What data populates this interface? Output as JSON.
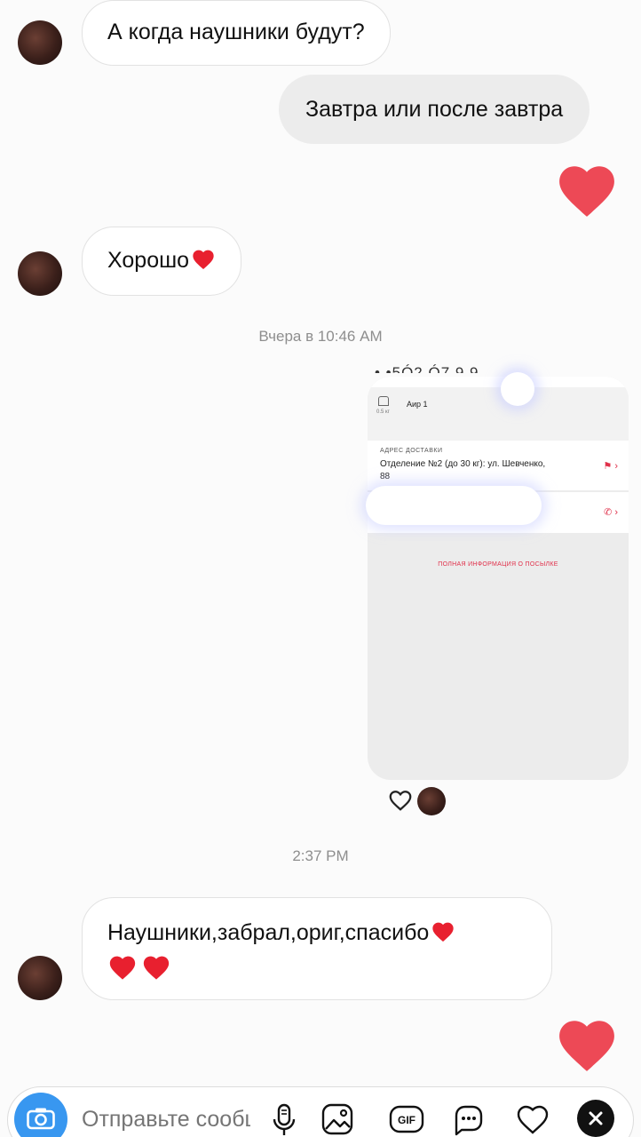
{
  "messages": {
    "m1": {
      "text": "А когда наушники будут?"
    },
    "m2": {
      "text": "Завтра или после завтра"
    },
    "m3": {
      "text": "Хорошо"
    },
    "m4": {
      "line1": "Наушники,забрал,ориг,спасибо"
    }
  },
  "timestamps": {
    "t1": "Вчера в 10:46 AM",
    "t2": "2:37 PM"
  },
  "shared_screenshot": {
    "cut_text": "• •5Ó2 Ó7 9 9",
    "package_weight": "0.5 кг",
    "package_name": "Аир 1",
    "address_label": "АДРЕС ДОСТАВКИ",
    "address_value": "Отделение №2 (до 30 кг): ул. Шевченко, 88",
    "full_info": "ПОЛНАЯ ИНФОРМАЦИЯ О ПОСЫЛКЕ"
  },
  "composer": {
    "placeholder": "Отправьте сообщение..."
  },
  "colors": {
    "heart": "#ed4956",
    "accent": "#3897f0",
    "parcel_red": "#e0304a"
  },
  "icons": [
    "camera-icon",
    "microphone-icon",
    "gallery-icon",
    "gif-icon",
    "sticker-icon",
    "heart-icon",
    "close-icon"
  ]
}
